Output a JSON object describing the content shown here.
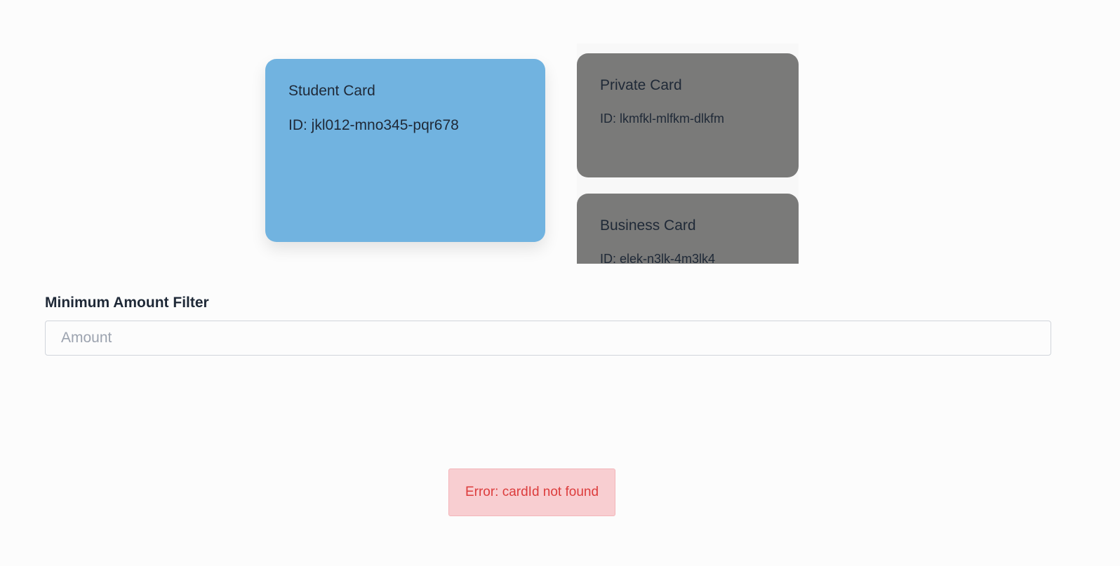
{
  "selected_card": {
    "name": "Student Card",
    "id_text": "ID: jkl012-mno345-pqr678",
    "color": "#71b3e0"
  },
  "card_list": [
    {
      "name": "Private Card",
      "id_text": "ID: lkmfkl-mlfkm-dlkfm",
      "color": "#7a7a79"
    },
    {
      "name": "Business Card",
      "id_text": "ID: elek-n3lk-4m3lk4",
      "color": "#7a7a79"
    }
  ],
  "filter": {
    "label": "Minimum Amount Filter",
    "placeholder": "Amount",
    "value": ""
  },
  "error": {
    "message": "Error: cardId not found",
    "color": "#dc3c3c",
    "background": "#f8ced1"
  }
}
